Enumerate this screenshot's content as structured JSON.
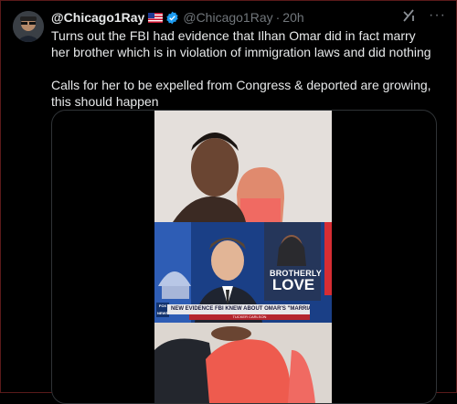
{
  "tweet": {
    "display_name": "@Chicago1Ray",
    "handle": "@Chicago1Ray",
    "separator": "·",
    "time": "20h",
    "text_paragraphs": [
      "Turns out the FBI had evidence that Ilhan Omar did in fact marry her brother which is in violation of  immigration laws and did nothing",
      "Calls for her to be expelled from Congress & deported are growing, this should happen"
    ],
    "more_label": "···"
  },
  "media": {
    "overlay_title_line1": "BROTHERLY",
    "overlay_title_line2": "LOVE",
    "chyron_text": "NEW EVIDENCE FBI KNEW ABOUT OMAR'S \"MARRIAGE\"",
    "chyron_sub": "TUCKER CARLSON",
    "network_logo": "FOX NEWS"
  },
  "colors": {
    "background": "#000000",
    "text": "#e7e9ea",
    "muted": "#71767b",
    "verified_blue": "#1d9bf0",
    "border": "#2f3336"
  }
}
